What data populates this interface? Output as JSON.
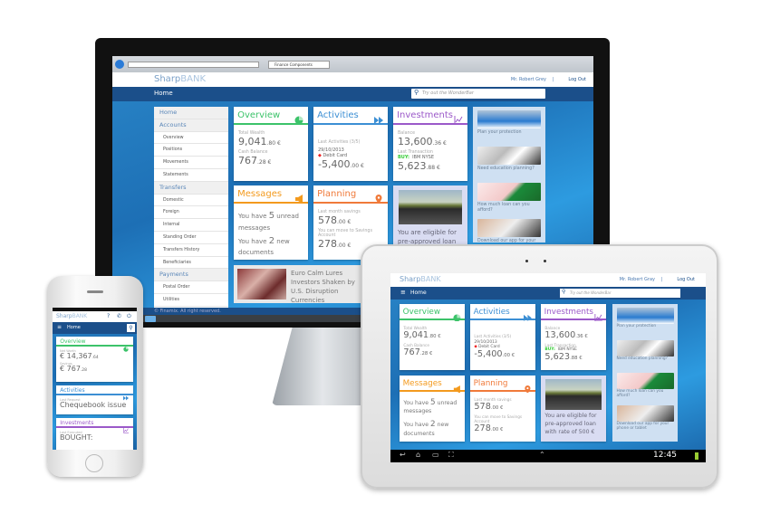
{
  "colors": {
    "overview": "#3cc36a",
    "activities": "#3c8fd4",
    "investments": "#9b59c9",
    "messages": "#f39a1e",
    "planning": "#f07a3a",
    "nav": "#1b4f8a",
    "promo": "#cfe0f2",
    "loan": "#d9dcf2"
  },
  "monitor": {
    "browser": {
      "tab": "Finance Components"
    },
    "header": {
      "brand_a": "Sharp",
      "brand_b": "BANK",
      "user": "Mr. Robert Grey",
      "sep": "|",
      "logout": "Log Out"
    },
    "nav": {
      "home": "Home",
      "search_placeholder": "Try out the WonderBar"
    },
    "sidebar": [
      {
        "label": "Home",
        "kind": "section"
      },
      {
        "label": "Accounts",
        "kind": "section"
      },
      {
        "label": "Overview",
        "kind": "item"
      },
      {
        "label": "Positions",
        "kind": "item"
      },
      {
        "label": "Movements",
        "kind": "item"
      },
      {
        "label": "Statements",
        "kind": "item"
      },
      {
        "label": "Transfers",
        "kind": "section"
      },
      {
        "label": "Domestic",
        "kind": "item"
      },
      {
        "label": "Foreign",
        "kind": "item"
      },
      {
        "label": "Internal",
        "kind": "item"
      },
      {
        "label": "Standing Order",
        "kind": "item"
      },
      {
        "label": "Transfers History",
        "kind": "item"
      },
      {
        "label": "Beneficiaries",
        "kind": "item"
      },
      {
        "label": "Payments",
        "kind": "section"
      },
      {
        "label": "Postal Order",
        "kind": "item"
      },
      {
        "label": "Utilities",
        "kind": "item"
      }
    ],
    "news": {
      "text": "Euro Calm Lures Investors Shaken by U.S. Disruption Currencies"
    },
    "footer": "© Finamix. All right reserved."
  },
  "cards": {
    "overview": {
      "title": "Overview",
      "icon": "pie-chart-icon",
      "rows": [
        {
          "k": "label",
          "t": "Total Wealth"
        },
        {
          "k": "value",
          "t": "9,041",
          "d": ".80 €"
        },
        {
          "k": "label",
          "t": "Cash Balance"
        },
        {
          "k": "value",
          "t": "767",
          "d": ".28 €"
        }
      ]
    },
    "activities": {
      "title": "Activities",
      "icon": "fast-forward-icon",
      "rows": [
        {
          "k": "gap"
        },
        {
          "k": "label",
          "t": "Last Activities (3/5)"
        },
        {
          "k": "small",
          "t": "29/10/2013"
        },
        {
          "k": "debit",
          "t": "Debit Card"
        },
        {
          "k": "value",
          "t": "-5,400",
          "d": ".00 €"
        }
      ]
    },
    "investments": {
      "title": "Investments",
      "icon": "line-chart-icon",
      "rows": [
        {
          "k": "label",
          "t": "Balance"
        },
        {
          "k": "value",
          "t": "13,600",
          "d": ".36 €"
        },
        {
          "k": "label",
          "t": "Last Transaction"
        },
        {
          "k": "buy",
          "t": "BUY:",
          "u": "IBM NYSE"
        },
        {
          "k": "value",
          "t": "5,623",
          "d": ".88 €"
        }
      ]
    },
    "messages": {
      "title": "Messages",
      "icon": "megaphone-icon",
      "rows": [
        {
          "k": "msg",
          "a": "You have ",
          "n": "5",
          "b": " unread messages"
        },
        {
          "k": "msg",
          "a": "You have ",
          "n": "2",
          "b": " new documents"
        }
      ]
    },
    "planning": {
      "title": "Planning",
      "icon": "map-pin-icon",
      "rows": [
        {
          "k": "label",
          "t": "Last month savings"
        },
        {
          "k": "value",
          "t": "578",
          "d": ".00 €"
        },
        {
          "k": "label",
          "t": "You can move to Savings Account"
        },
        {
          "k": "value",
          "t": "278",
          "d": ".00 €"
        }
      ]
    }
  },
  "loan": {
    "text": "You are eligible for pre-approved loan with rate of 500 €"
  },
  "promos": [
    "Plan your protection",
    "Need education planning?",
    "How much loan can you afford?",
    "Download our app for your phone or tablet"
  ],
  "tablet": {
    "user": "Mr. Robert Gray",
    "sep": "|",
    "logout": "Log Out",
    "home": "Home",
    "search_placeholder": "Try out the WonderBar",
    "clock": "12:45"
  },
  "phone": {
    "home": "Home",
    "overview": {
      "title": "Overview",
      "l1": "Net Worth",
      "v1": "€ 14,367",
      "d1": ".64",
      "l2": "Savings",
      "v2": "€ 767",
      "d2": ".28"
    },
    "activities": {
      "title": "Activities",
      "l1": "Last Request",
      "v1": "Chequebook issue"
    },
    "investments": {
      "title": "Investments",
      "l1": "Last Executed",
      "v1": "BOUGHT:"
    }
  }
}
